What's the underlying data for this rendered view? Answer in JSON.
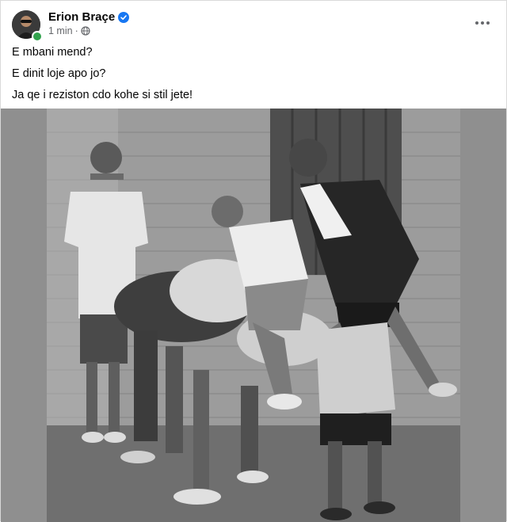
{
  "post": {
    "author": "Erion Braçe",
    "time": "1 min",
    "visibility_icon": "globe-icon",
    "verified_icon": "verified-badge-icon",
    "more_icon": "more-options-icon",
    "lines": [
      "E mbani mend?",
      "E dinit loje apo jo?",
      "Ja qe i reziston cdo kohe si stil jete!"
    ]
  },
  "colors": {
    "verified": "#1877f2",
    "online": "#31a24c",
    "meta_text": "#65676b",
    "photo_letterbox": "#8f8f8f"
  }
}
